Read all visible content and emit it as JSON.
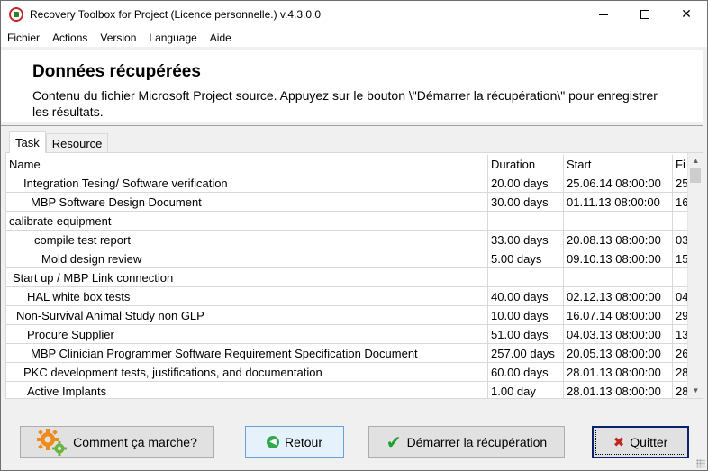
{
  "window": {
    "title": "Recovery Toolbox for Project (Licence personnelle.) v.4.3.0.0"
  },
  "menu": [
    "Fichier",
    "Actions",
    "Version",
    "Language",
    "Aide"
  ],
  "header": {
    "title": "Données récupérées",
    "description": "Contenu du fichier Microsoft Project source. Appuyez sur le bouton \\\"Démarrer la récupération\\\" pour enregistrer les résultats."
  },
  "tabs": [
    {
      "label": "Task",
      "active": true
    },
    {
      "label": "Resource",
      "active": false
    }
  ],
  "grid": {
    "columns": [
      "Name",
      "Duration",
      "Start",
      "Fi"
    ],
    "rows": [
      {
        "name": "Integration Tesing/ Software verification",
        "indent": 4,
        "duration": "20.00 days",
        "start": "25.06.14 08:00:00",
        "finish": "25"
      },
      {
        "name": "MBP Software Design Document",
        "indent": 6,
        "duration": "30.00 days",
        "start": "01.11.13 08:00:00",
        "finish": "16"
      },
      {
        "name": "calibrate equipment",
        "indent": 0,
        "duration": "",
        "start": "",
        "finish": ""
      },
      {
        "name": "compile test report",
        "indent": 7,
        "duration": "33.00 days",
        "start": "20.08.13 08:00:00",
        "finish": "03"
      },
      {
        "name": "Mold design review",
        "indent": 9,
        "duration": "5.00 days",
        "start": "09.10.13 08:00:00",
        "finish": "15"
      },
      {
        "name": "Start up / MBP Link connection",
        "indent": 1,
        "duration": "",
        "start": "",
        "finish": ""
      },
      {
        "name": "HAL white box tests",
        "indent": 5,
        "duration": "40.00 days",
        "start": "02.12.13 08:00:00",
        "finish": "04"
      },
      {
        "name": "Non-Survival Animal Study non GLP",
        "indent": 2,
        "duration": "10.00 days",
        "start": "16.07.14 08:00:00",
        "finish": "29"
      },
      {
        "name": "Procure Supplier",
        "indent": 5,
        "duration": "51.00 days",
        "start": "04.03.13 08:00:00",
        "finish": "13"
      },
      {
        "name": "MBP Clinician Programmer Software Requirement Specification Document",
        "indent": 6,
        "duration": "257.00 days",
        "start": "20.05.13 08:00:00",
        "finish": "26"
      },
      {
        "name": "PKC development tests, justifications, and documentation",
        "indent": 4,
        "duration": "60.00 days",
        "start": "28.01.13 08:00:00",
        "finish": "28"
      },
      {
        "name": "Active Implants",
        "indent": 5,
        "duration": "1.00 day",
        "start": "28.01.13 08:00:00",
        "finish": "28"
      }
    ]
  },
  "buttons": {
    "how": "Comment ça marche?",
    "back": "Retour",
    "start": "Démarrer la récupération",
    "quit": "Quitter"
  },
  "icons": {
    "app": "recovery-toolbox-app-icon",
    "how": "gears-icon",
    "back": "back-arrow-icon",
    "start": "checkmark-icon",
    "quit": "x-icon"
  },
  "colors": {
    "accent_green": "#2fa84f",
    "gear_orange": "#f08a1c",
    "gear_green": "#6cb33f",
    "quit_red": "#c0261d",
    "focus_border": "#0a246a"
  }
}
